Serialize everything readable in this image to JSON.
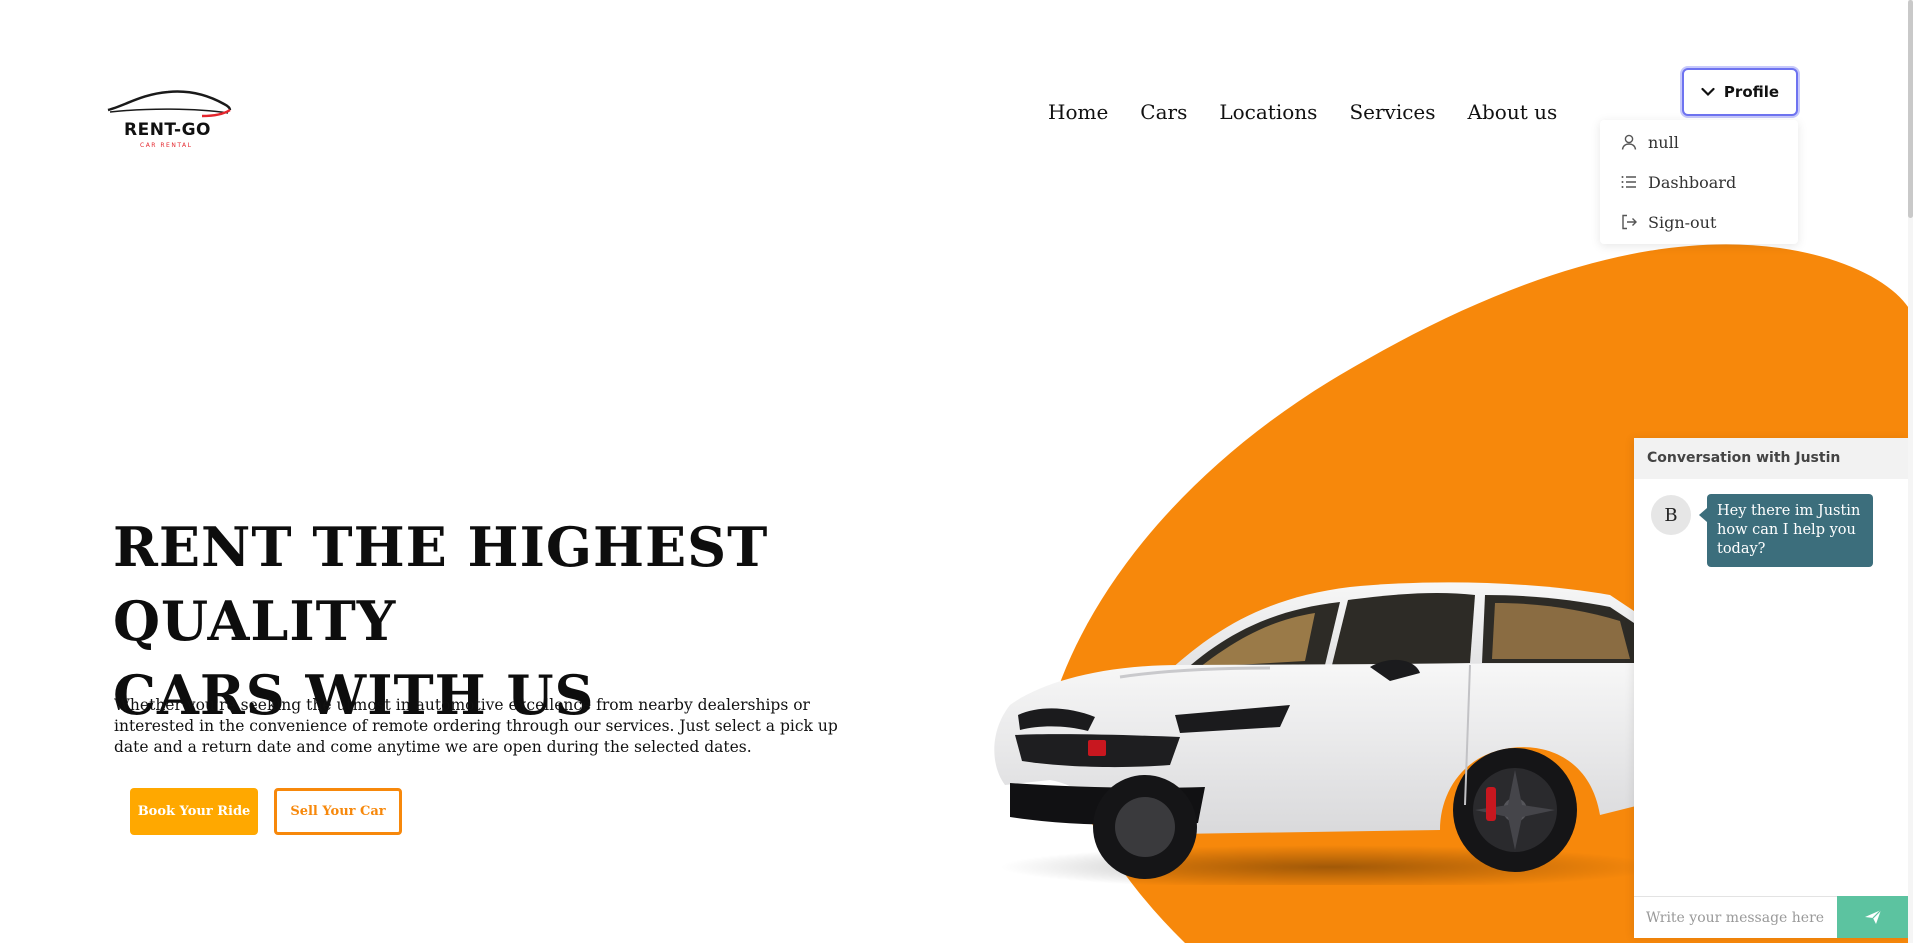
{
  "logo": {
    "name": "RENT-GO",
    "tagline": "CAR RENTAL"
  },
  "nav": {
    "items": [
      "Home",
      "Cars",
      "Locations",
      "Services",
      "About us"
    ]
  },
  "profile": {
    "button_label": "Profile",
    "menu": [
      {
        "label": "null",
        "icon": "user-icon"
      },
      {
        "label": "Dashboard",
        "icon": "list-icon"
      },
      {
        "label": "Sign-out",
        "icon": "sign-out-icon"
      }
    ]
  },
  "hero": {
    "title_line1": "RENT THE HIGHEST QUALITY",
    "title_line2": "CARS WITH US",
    "description": "Whether you're seeking the utmost in automotive excellence from nearby dealerships or interested in the convenience of remote ordering through our services. Just select a pick up date and a return date and come anytime we are open during the selected dates.",
    "primary_button": "Book Your Ride",
    "secondary_button": "Sell Your Car"
  },
  "chat": {
    "title": "Conversation with Justin",
    "avatar_initial": "B",
    "message": "Hey there im Justin how can I help you today?",
    "input_placeholder": "Write your message here"
  },
  "colors": {
    "accent_orange": "#f7880b",
    "button_yellow": "#ffa800",
    "chat_bubble": "#3c6e7c",
    "send_button": "#5cc3a0",
    "profile_border": "#6e73f0"
  }
}
